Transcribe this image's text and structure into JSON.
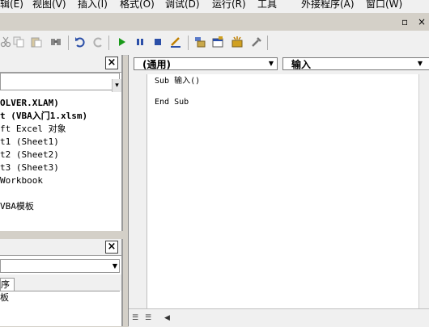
{
  "menu": {
    "items": [
      "辑(E)",
      "视图(V)",
      "插入(I)",
      "格式(O)",
      "调试(D)",
      "运行(R)",
      "工具",
      "外接程序(A)",
      "窗口(W)"
    ]
  },
  "window_controls": {
    "restore": "▫",
    "close": "×"
  },
  "project_pane": {
    "tree": [
      "OLVER.XLAM)",
      "t (VBA入门1.xlsm)",
      "ft Excel 对象",
      "t1 (Sheet1)",
      "t2 (Sheet2)",
      "t3 (Sheet3)",
      "Workbook",
      "",
      "VBA模板"
    ]
  },
  "props_pane": {
    "tab_label": "序",
    "row_value": "板"
  },
  "code_window": {
    "object_combo": "(通用)",
    "proc_combo": "输入",
    "lines": [
      "Sub 输入()",
      "",
      "End Sub"
    ]
  },
  "colors": {
    "run_green": "#1a9a1a",
    "help_blue": "#2c5aa8",
    "stop_blue": "#2b4fa8"
  },
  "icons": [
    "cut-icon",
    "copy-icon",
    "paste-icon",
    "find-icon",
    "undo-icon",
    "redo-icon",
    "run-icon",
    "pause-icon",
    "stop-icon",
    "design-mode-icon",
    "project-explorer-icon",
    "properties-icon",
    "object-browser-icon",
    "toolbox-icon",
    "help-icon"
  ]
}
